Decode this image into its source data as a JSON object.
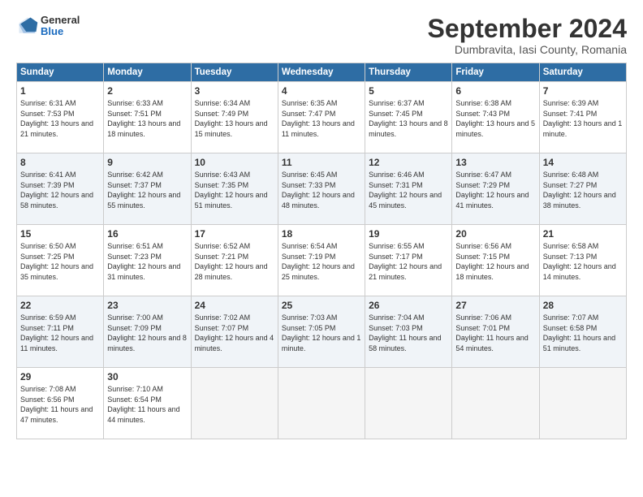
{
  "header": {
    "logo": {
      "general": "General",
      "blue": "Blue"
    },
    "title": "September 2024",
    "location": "Dumbravita, Iasi County, Romania"
  },
  "weekdays": [
    "Sunday",
    "Monday",
    "Tuesday",
    "Wednesday",
    "Thursday",
    "Friday",
    "Saturday"
  ],
  "weeks": [
    [
      {
        "day": "1",
        "sunrise": "6:31 AM",
        "sunset": "7:53 PM",
        "daylight": "13 hours and 21 minutes."
      },
      {
        "day": "2",
        "sunrise": "6:33 AM",
        "sunset": "7:51 PM",
        "daylight": "13 hours and 18 minutes."
      },
      {
        "day": "3",
        "sunrise": "6:34 AM",
        "sunset": "7:49 PM",
        "daylight": "13 hours and 15 minutes."
      },
      {
        "day": "4",
        "sunrise": "6:35 AM",
        "sunset": "7:47 PM",
        "daylight": "13 hours and 11 minutes."
      },
      {
        "day": "5",
        "sunrise": "6:37 AM",
        "sunset": "7:45 PM",
        "daylight": "13 hours and 8 minutes."
      },
      {
        "day": "6",
        "sunrise": "6:38 AM",
        "sunset": "7:43 PM",
        "daylight": "13 hours and 5 minutes."
      },
      {
        "day": "7",
        "sunrise": "6:39 AM",
        "sunset": "7:41 PM",
        "daylight": "13 hours and 1 minute."
      }
    ],
    [
      {
        "day": "8",
        "sunrise": "6:41 AM",
        "sunset": "7:39 PM",
        "daylight": "12 hours and 58 minutes."
      },
      {
        "day": "9",
        "sunrise": "6:42 AM",
        "sunset": "7:37 PM",
        "daylight": "12 hours and 55 minutes."
      },
      {
        "day": "10",
        "sunrise": "6:43 AM",
        "sunset": "7:35 PM",
        "daylight": "12 hours and 51 minutes."
      },
      {
        "day": "11",
        "sunrise": "6:45 AM",
        "sunset": "7:33 PM",
        "daylight": "12 hours and 48 minutes."
      },
      {
        "day": "12",
        "sunrise": "6:46 AM",
        "sunset": "7:31 PM",
        "daylight": "12 hours and 45 minutes."
      },
      {
        "day": "13",
        "sunrise": "6:47 AM",
        "sunset": "7:29 PM",
        "daylight": "12 hours and 41 minutes."
      },
      {
        "day": "14",
        "sunrise": "6:48 AM",
        "sunset": "7:27 PM",
        "daylight": "12 hours and 38 minutes."
      }
    ],
    [
      {
        "day": "15",
        "sunrise": "6:50 AM",
        "sunset": "7:25 PM",
        "daylight": "12 hours and 35 minutes."
      },
      {
        "day": "16",
        "sunrise": "6:51 AM",
        "sunset": "7:23 PM",
        "daylight": "12 hours and 31 minutes."
      },
      {
        "day": "17",
        "sunrise": "6:52 AM",
        "sunset": "7:21 PM",
        "daylight": "12 hours and 28 minutes."
      },
      {
        "day": "18",
        "sunrise": "6:54 AM",
        "sunset": "7:19 PM",
        "daylight": "12 hours and 25 minutes."
      },
      {
        "day": "19",
        "sunrise": "6:55 AM",
        "sunset": "7:17 PM",
        "daylight": "12 hours and 21 minutes."
      },
      {
        "day": "20",
        "sunrise": "6:56 AM",
        "sunset": "7:15 PM",
        "daylight": "12 hours and 18 minutes."
      },
      {
        "day": "21",
        "sunrise": "6:58 AM",
        "sunset": "7:13 PM",
        "daylight": "12 hours and 14 minutes."
      }
    ],
    [
      {
        "day": "22",
        "sunrise": "6:59 AM",
        "sunset": "7:11 PM",
        "daylight": "12 hours and 11 minutes."
      },
      {
        "day": "23",
        "sunrise": "7:00 AM",
        "sunset": "7:09 PM",
        "daylight": "12 hours and 8 minutes."
      },
      {
        "day": "24",
        "sunrise": "7:02 AM",
        "sunset": "7:07 PM",
        "daylight": "12 hours and 4 minutes."
      },
      {
        "day": "25",
        "sunrise": "7:03 AM",
        "sunset": "7:05 PM",
        "daylight": "12 hours and 1 minute."
      },
      {
        "day": "26",
        "sunrise": "7:04 AM",
        "sunset": "7:03 PM",
        "daylight": "11 hours and 58 minutes."
      },
      {
        "day": "27",
        "sunrise": "7:06 AM",
        "sunset": "7:01 PM",
        "daylight": "11 hours and 54 minutes."
      },
      {
        "day": "28",
        "sunrise": "7:07 AM",
        "sunset": "6:58 PM",
        "daylight": "11 hours and 51 minutes."
      }
    ],
    [
      {
        "day": "29",
        "sunrise": "7:08 AM",
        "sunset": "6:56 PM",
        "daylight": "11 hours and 47 minutes."
      },
      {
        "day": "30",
        "sunrise": "7:10 AM",
        "sunset": "6:54 PM",
        "daylight": "11 hours and 44 minutes."
      },
      null,
      null,
      null,
      null,
      null
    ]
  ]
}
